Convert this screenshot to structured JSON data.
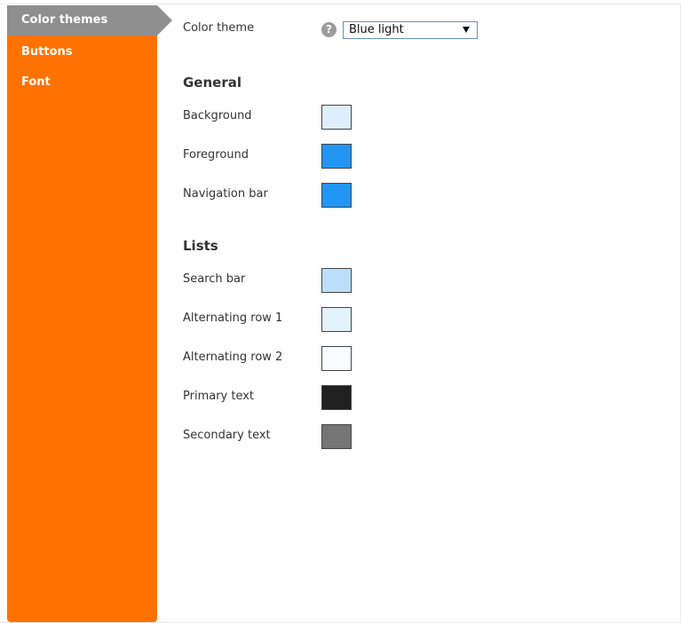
{
  "sidebar": {
    "items": [
      {
        "label": "Color themes",
        "active": true
      },
      {
        "label": "Buttons",
        "active": false
      },
      {
        "label": "Font",
        "active": false
      }
    ]
  },
  "theme": {
    "label": "Color theme",
    "help_icon": "?",
    "selected": "Blue light"
  },
  "general": {
    "heading": "General",
    "rows": [
      {
        "label": "Background",
        "color": "#dfefff"
      },
      {
        "label": "Foreground",
        "color": "#2196f3"
      },
      {
        "label": "Navigation bar",
        "color": "#2196f3"
      }
    ]
  },
  "lists": {
    "heading": "Lists",
    "rows": [
      {
        "label": "Search bar",
        "color": "#bbdefb"
      },
      {
        "label": "Alternating row 1",
        "color": "#e3f2fd"
      },
      {
        "label": "Alternating row 2",
        "color": "#f8fbff"
      },
      {
        "label": "Primary text",
        "color": "#212121"
      },
      {
        "label": "Secondary text",
        "color": "#757575"
      }
    ]
  },
  "colors": {
    "sidebar_bg": "#ff7200",
    "sidebar_active": "#8f8f8f"
  }
}
